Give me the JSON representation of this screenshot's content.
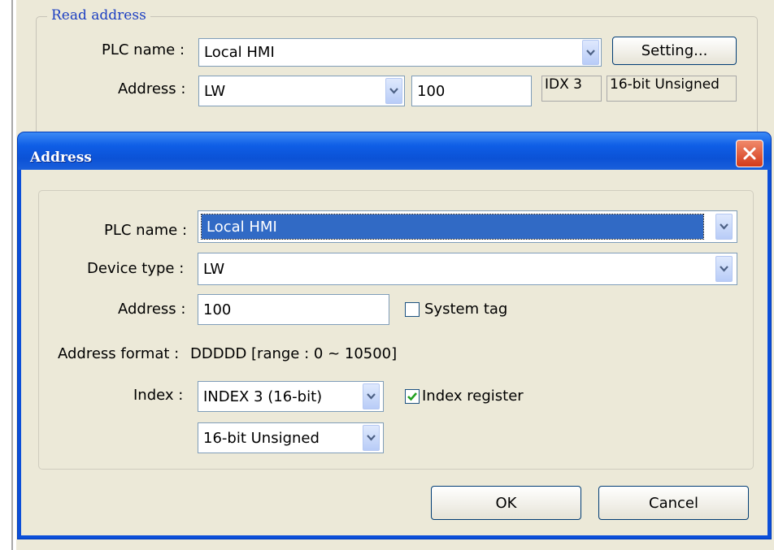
{
  "read_address": {
    "group_title": "Read address",
    "plc_name_label": "PLC name :",
    "plc_name_value": "Local HMI",
    "setting_button": "Setting...",
    "address_label": "Address :",
    "device_value": "LW",
    "address_value": "100",
    "index_text": "IDX 3",
    "format_text": "16-bit Unsigned"
  },
  "dialog": {
    "title": "Address",
    "plc_name_label": "PLC name :",
    "plc_name_value": "Local HMI",
    "device_type_label": "Device type :",
    "device_type_value": "LW",
    "address_label": "Address :",
    "address_value": "100",
    "system_tag_label": "System tag",
    "system_tag_checked": false,
    "address_format_label": "Address format :",
    "address_format_value": "DDDDD [range : 0 ~ 10500]",
    "index_label": "Index :",
    "index_value": "INDEX 3 (16-bit)",
    "index_register_label": "Index register",
    "index_register_checked": true,
    "data_format_value": "16-bit Unsigned",
    "ok_button": "OK",
    "cancel_button": "Cancel"
  },
  "colors": {
    "titlebar": "#0b52d6",
    "panel": "#ece9d8",
    "group_title": "#1c3fc2",
    "selection": "#316ac5",
    "close": "#d3391a"
  }
}
